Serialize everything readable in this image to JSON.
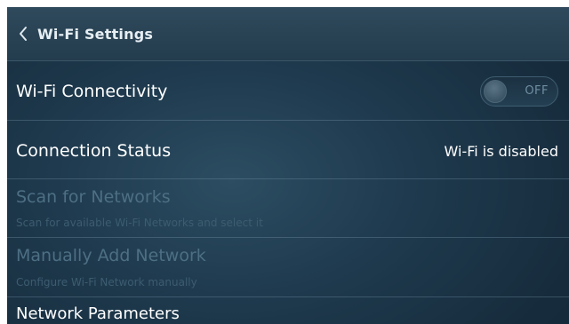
{
  "header": {
    "title": "Wi-Fi Settings"
  },
  "rows": {
    "wifi_connectivity": {
      "label": "Wi-Fi Connectivity",
      "toggle_state": "OFF"
    },
    "connection_status": {
      "label": "Connection Status",
      "value": "Wi-Fi is disabled"
    },
    "scan_networks": {
      "label": "Scan for Networks",
      "sublabel": "Scan for available Wi-Fi Networks and select it"
    },
    "manual_add": {
      "label": "Manually Add Network",
      "sublabel": "Configure Wi-Fi Network manually"
    },
    "network_parameters": {
      "label": "Network Parameters"
    }
  },
  "colors": {
    "background": "#1f3a4e",
    "header": "#2a4557",
    "text_primary": "#ffffff",
    "text_disabled": "#4d6f84",
    "text_sub_disabled": "#3c5c70"
  },
  "icons": {
    "back": "chevron-left-icon"
  }
}
